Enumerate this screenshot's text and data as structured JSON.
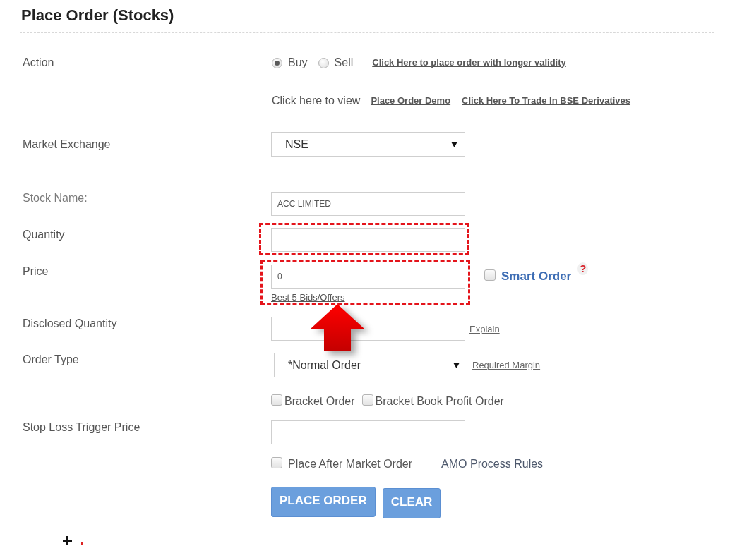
{
  "title": "Place Order (Stocks)",
  "action": {
    "label": "Action",
    "options": [
      {
        "label": "Buy",
        "selected": true
      },
      {
        "label": "Sell",
        "selected": false
      }
    ],
    "link": "Click Here to place order with longer validity"
  },
  "view_row": {
    "text": "Click here to view",
    "links": [
      "Place Order Demo",
      "Click Here To Trade In BSE Derivatives"
    ]
  },
  "market_exchange": {
    "label": "Market Exchange",
    "value": "NSE"
  },
  "stock_name": {
    "label": "Stock Name:",
    "value": "ACC LIMITED"
  },
  "quantity": {
    "label": "Quantity",
    "highlighted": true
  },
  "price": {
    "label": "Price",
    "value": "0",
    "highlighted": true,
    "link": "Best 5 Bids/Offers",
    "smart_order": {
      "label": "Smart Order",
      "checked": false,
      "help": "?"
    }
  },
  "disclosed_quantity": {
    "label": "Disclosed Quantity",
    "link": "Explain"
  },
  "order_type": {
    "label": "Order Type",
    "value": "*Normal Order",
    "link": "Required Margin"
  },
  "bracket_options": [
    {
      "label": "Bracket Order",
      "checked": false
    },
    {
      "label": "Bracket Book Profit Order",
      "checked": false
    }
  ],
  "stop_loss_trigger_price": {
    "label": "Stop Loss Trigger Price"
  },
  "after_market_order": {
    "label": "Place After Market Order",
    "checked": false,
    "rules": "AMO Process Rules"
  },
  "buttons": [
    "PLACE ORDER",
    "CLEAR"
  ]
}
